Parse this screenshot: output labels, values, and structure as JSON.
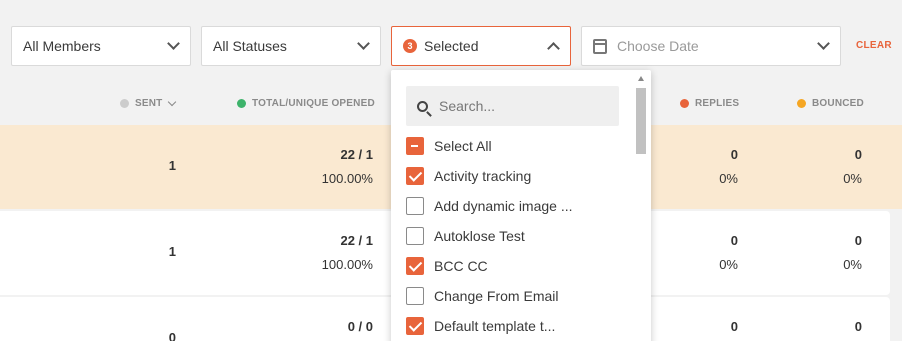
{
  "filters": {
    "members": "All Members",
    "statuses": "All Statuses",
    "selected_count": "3",
    "selected_label": "Selected",
    "date_placeholder": "Choose Date",
    "clear": "CLEAR"
  },
  "columns": {
    "sent": "SENT",
    "opened": "TOTAL/UNIQUE OPENED",
    "replies": "REPLIES",
    "bounced": "BOUNCED"
  },
  "colors": {
    "accent": "#e8643b",
    "sent_dot": "#cccccc",
    "opened_dot": "#3db36b",
    "replies_dot": "#e8643b",
    "bounced_dot": "#f5a623"
  },
  "rows": [
    {
      "sent": "1",
      "opened": "22 / 1",
      "opened_pct": "100.00%",
      "replies": "0",
      "replies_pct": "0%",
      "bounced": "0",
      "bounced_pct": "0%"
    },
    {
      "sent": "1",
      "opened": "22 / 1",
      "opened_pct": "100.00%",
      "replies": "0",
      "replies_pct": "0%",
      "bounced": "0",
      "bounced_pct": "0%"
    },
    {
      "sent": "0",
      "opened": "0 / 0",
      "replies": "0",
      "bounced": "0"
    }
  ],
  "dropdown": {
    "search_placeholder": "Search...",
    "options": [
      {
        "label": "Select All",
        "state": "mixed"
      },
      {
        "label": "Activity tracking",
        "state": "checked"
      },
      {
        "label": "Add dynamic image ...",
        "state": "unchecked"
      },
      {
        "label": "Autoklose Test",
        "state": "unchecked"
      },
      {
        "label": "BCC CC",
        "state": "checked"
      },
      {
        "label": "Change From Email",
        "state": "unchecked"
      },
      {
        "label": "Default template t...",
        "state": "checked"
      }
    ]
  }
}
